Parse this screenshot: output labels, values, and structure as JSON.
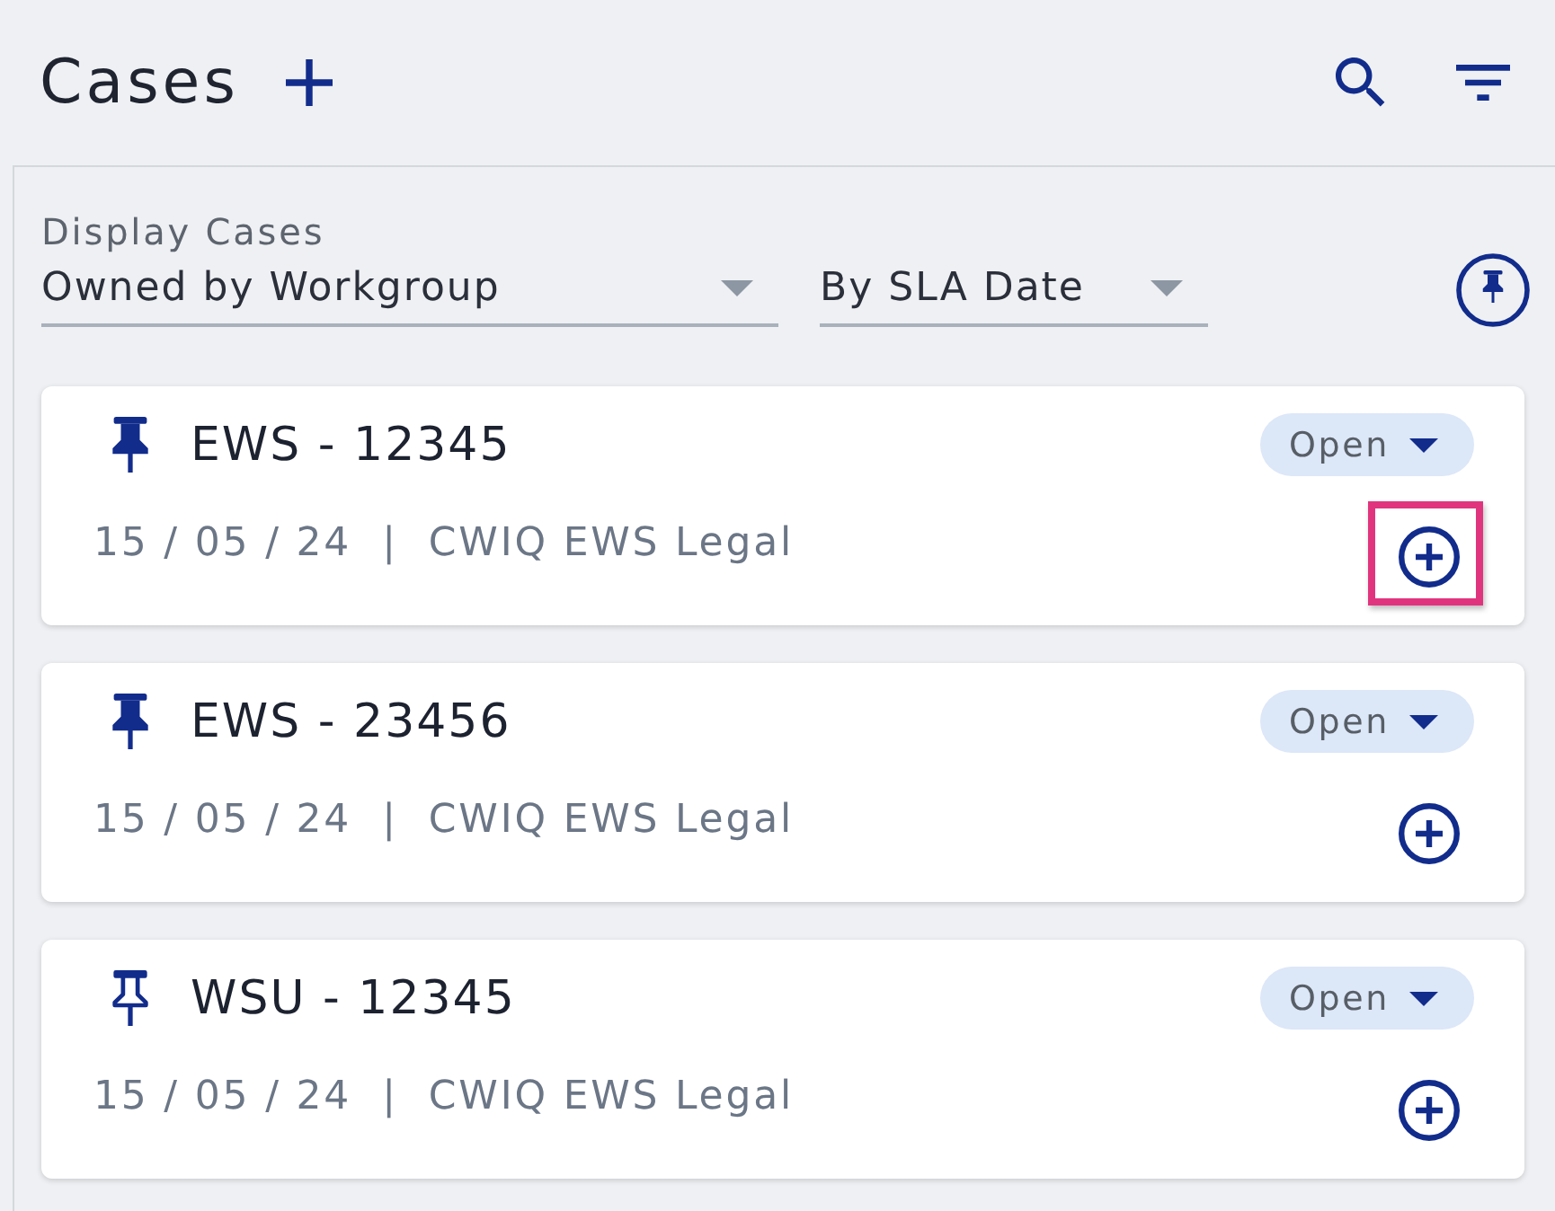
{
  "header": {
    "title": "Cases"
  },
  "filters": {
    "label": "Display Cases",
    "owner_select": {
      "value": "Owned by Workgroup"
    },
    "sort_select": {
      "value": "By SLA Date"
    }
  },
  "cases": [
    {
      "title": "EWS - 12345",
      "pinned": true,
      "date": "15 / 05 / 24",
      "separator": "|",
      "group": "CWIQ EWS Legal",
      "status": "Open",
      "highlighted": true
    },
    {
      "title": "EWS - 23456",
      "pinned": true,
      "date": "15 / 05 / 24",
      "separator": "|",
      "group": "CWIQ EWS Legal",
      "status": "Open",
      "highlighted": false
    },
    {
      "title": "WSU - 12345",
      "pinned": false,
      "date": "15 / 05 / 24",
      "separator": "|",
      "group": "CWIQ EWS Legal",
      "status": "Open",
      "highlighted": false
    }
  ]
}
